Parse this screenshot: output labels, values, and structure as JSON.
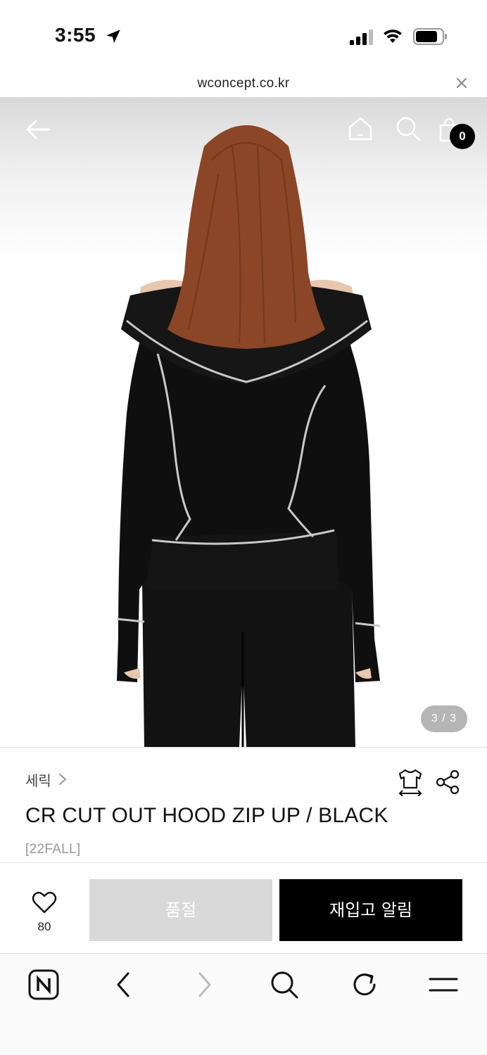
{
  "status_bar": {
    "time": "3:55"
  },
  "browser": {
    "url": "wconcept.co.kr"
  },
  "product": {
    "brand": "세릭",
    "title": "CR CUT OUT HOOD ZIP UP / BLACK",
    "season": "[22FALL]",
    "image_pager": "3 / 3"
  },
  "cart": {
    "count": "0"
  },
  "actions": {
    "like_count": "80",
    "soldout_label": "품절",
    "restock_label": "재입고 알림"
  },
  "icons": {
    "nav": [
      "back-arrow-icon",
      "home-icon",
      "search-icon",
      "shopping-bag-icon"
    ],
    "info": [
      "chevron-right-icon",
      "size-guide-icon",
      "share-icon",
      "heart-icon"
    ],
    "toolbar": [
      "naver-icon",
      "back-icon",
      "forward-icon",
      "search-icon",
      "reload-icon",
      "menu-icon"
    ]
  },
  "colors": {
    "accent": "#000000",
    "soldout_bg": "#d9d9d9",
    "pager_bg": "#8a8a8a"
  }
}
